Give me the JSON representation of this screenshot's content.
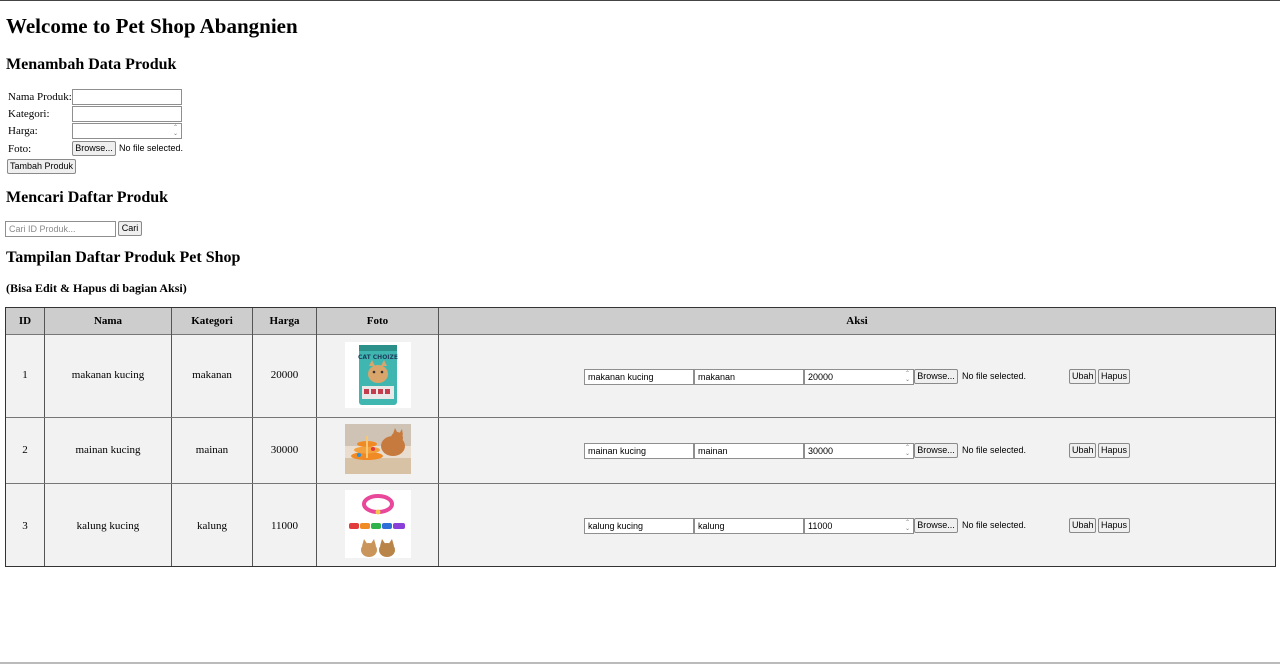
{
  "page": {
    "title": "Welcome to Pet Shop Abangnien"
  },
  "add_form": {
    "heading": "Menambah Data Produk",
    "nama_label": "Nama Produk:",
    "nama_value": "",
    "kategori_label": "Kategori:",
    "kategori_value": "",
    "harga_label": "Harga:",
    "harga_value": "",
    "foto_label": "Foto:",
    "browse_label": "Browse...",
    "file_status": "No file selected.",
    "submit_label": "Tambah Produk"
  },
  "search": {
    "heading": "Mencari Daftar Produk",
    "placeholder": "Cari ID Produk...",
    "button_label": "Cari"
  },
  "list": {
    "heading": "Tampilan Daftar Produk Pet Shop",
    "subheading": "(Bisa Edit & Hapus di bagian Aksi)",
    "columns": [
      "ID",
      "Nama",
      "Kategori",
      "Harga",
      "Foto",
      "Aksi"
    ],
    "rows": [
      {
        "id": "1",
        "nama": "makanan kucing",
        "kategori": "makanan",
        "harga": "20000",
        "photo_icon": "cat-food-bag-photo",
        "edit_nama": "makanan kucing",
        "edit_kategori": "makanan",
        "edit_harga": "20000",
        "browse_label": "Browse...",
        "file_status": "No file selected.",
        "ubah_label": "Ubah",
        "hapus_label": "Hapus"
      },
      {
        "id": "2",
        "nama": "mainan kucing",
        "kategori": "mainan",
        "harga": "30000",
        "photo_icon": "cat-toy-photo",
        "edit_nama": "mainan kucing",
        "edit_kategori": "mainan",
        "edit_harga": "30000",
        "browse_label": "Browse...",
        "file_status": "No file selected.",
        "ubah_label": "Ubah",
        "hapus_label": "Hapus"
      },
      {
        "id": "3",
        "nama": "kalung kucing",
        "kategori": "kalung",
        "harga": "11000",
        "photo_icon": "cat-collar-photo",
        "edit_nama": "kalung kucing",
        "edit_kategori": "kalung",
        "edit_harga": "11000",
        "browse_label": "Browse...",
        "file_status": "No file selected.",
        "ubah_label": "Ubah",
        "hapus_label": "Hapus"
      }
    ]
  },
  "product_photo_text": {
    "cat_food_brand": "CAT CHOIZE"
  },
  "colors": {
    "header_bg": "#cdcdcd",
    "row_bg": "#f2f2f2",
    "button_bg": "#efefef"
  }
}
